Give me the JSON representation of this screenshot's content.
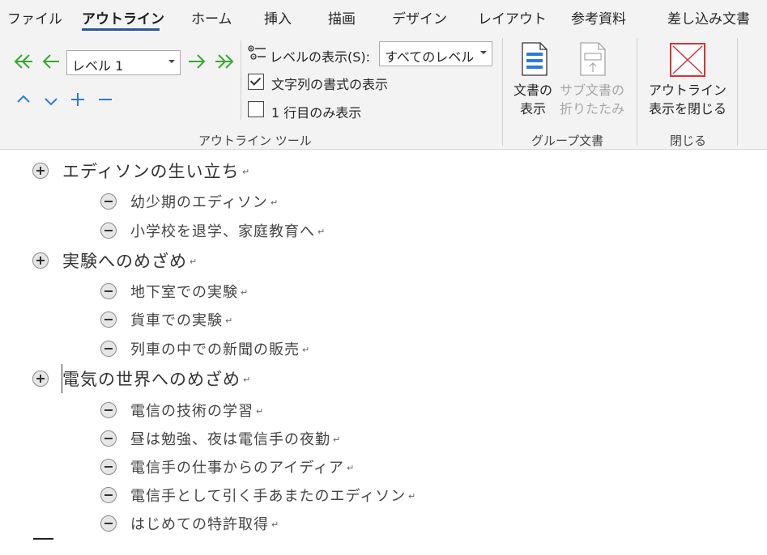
{
  "tabs": [
    {
      "label": "ファイル",
      "active": false
    },
    {
      "label": "アウトライン",
      "active": true
    },
    {
      "label": "ホーム",
      "active": false
    },
    {
      "label": "挿入",
      "active": false
    },
    {
      "label": "描画",
      "active": false
    },
    {
      "label": "デザイン",
      "active": false
    },
    {
      "label": "レイアウト",
      "active": false
    },
    {
      "label": "参考資料",
      "active": false
    },
    {
      "label": "差し込み文書",
      "active": false
    }
  ],
  "outline_tools": {
    "promote_to_heading1_icon": "double-left-arrow-icon",
    "promote_icon": "left-arrow-icon",
    "level_value": "レベル 1",
    "demote_icon": "right-arrow-icon",
    "demote_to_body_icon": "double-right-arrow-icon",
    "move_up_icon": "chevron-up-icon",
    "move_down_icon": "chevron-down-icon",
    "expand_icon": "plus-icon",
    "collapse_icon": "minus-icon",
    "show_level_label": "レベルの表示(S):",
    "show_level_value": "すべてのレベル",
    "show_text_formatting_label": "文字列の書式の表示",
    "show_text_formatting_checked": true,
    "show_first_line_only_label": "1 行目のみ表示",
    "show_first_line_only_checked": false,
    "group_label": "アウトライン ツール"
  },
  "master_document": {
    "show_document_line1": "文書の",
    "show_document_line2": "表示",
    "collapse_subdocs_line1": "サブ文書の",
    "collapse_subdocs_line2": "折りたたみ",
    "group_label": "グループ文書"
  },
  "close_group": {
    "close_outline_line1": "アウトライン",
    "close_outline_line2": "表示を閉じる",
    "group_label": "閉じる"
  },
  "colors": {
    "accent": "#2b579a",
    "arrow_green": "#3aa635",
    "arrow_blue": "#2b7cd3",
    "close_red": "#d13438"
  },
  "outline": [
    {
      "level": 1,
      "text": "エディソンの生い立ち"
    },
    {
      "level": 2,
      "text": "幼少期のエディソン"
    },
    {
      "level": 2,
      "text": "小学校を退学、家庭教育へ"
    },
    {
      "level": 1,
      "text": "実験へのめざめ"
    },
    {
      "level": 2,
      "text": "地下室での実験"
    },
    {
      "level": 2,
      "text": "貨車での実験"
    },
    {
      "level": 2,
      "text": "列車の中での新聞の販売"
    },
    {
      "level": 1,
      "text": "電気の世界へのめざめ"
    },
    {
      "level": 2,
      "text": "電信の技術の学習"
    },
    {
      "level": 2,
      "text": "昼は勉強、夜は電信手の夜勤"
    },
    {
      "level": 2,
      "text": "電信手の仕事からのアイディア"
    },
    {
      "level": 2,
      "text": "電信手として引く手あまたのエディソン"
    },
    {
      "level": 2,
      "text": "はじめての特許取得"
    }
  ],
  "paragraph_mark": "↵"
}
